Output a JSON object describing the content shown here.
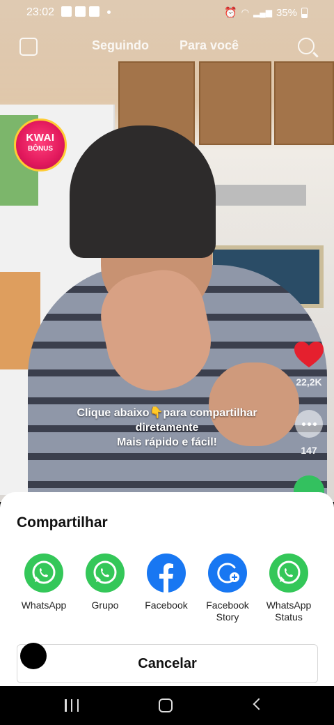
{
  "status_bar": {
    "time": "23:02",
    "battery": "35%"
  },
  "top_nav": {
    "tab_following": "Seguindo",
    "tab_for_you": "Para você"
  },
  "kwai_badge": {
    "line1": "KWAI",
    "line2": "BÔNUS"
  },
  "actions": {
    "like_count": "22,2K",
    "comment_count": "147"
  },
  "caption": {
    "line1": "Clique abaixo👇para compartilhar",
    "line2": "diretamente",
    "line3": "Mais rápido e fácil!"
  },
  "share_sheet": {
    "title": "Compartilhar",
    "items": [
      {
        "label": "WhatsApp",
        "icon": "whatsapp-icon",
        "color": "#34c759"
      },
      {
        "label": "Grupo",
        "icon": "whatsapp-icon",
        "color": "#34c759"
      },
      {
        "label": "Facebook",
        "icon": "facebook-icon",
        "color": "#1877f2"
      },
      {
        "label": "Facebook Story",
        "icon": "facebook-story-icon",
        "color": "#1877f2"
      },
      {
        "label": "WhatsApp Status",
        "icon": "whatsapp-icon",
        "color": "#34c759"
      }
    ],
    "cancel_label": "Cancelar"
  },
  "colors": {
    "like": "#e5202e",
    "whatsapp": "#34c759",
    "facebook": "#1877f2"
  }
}
